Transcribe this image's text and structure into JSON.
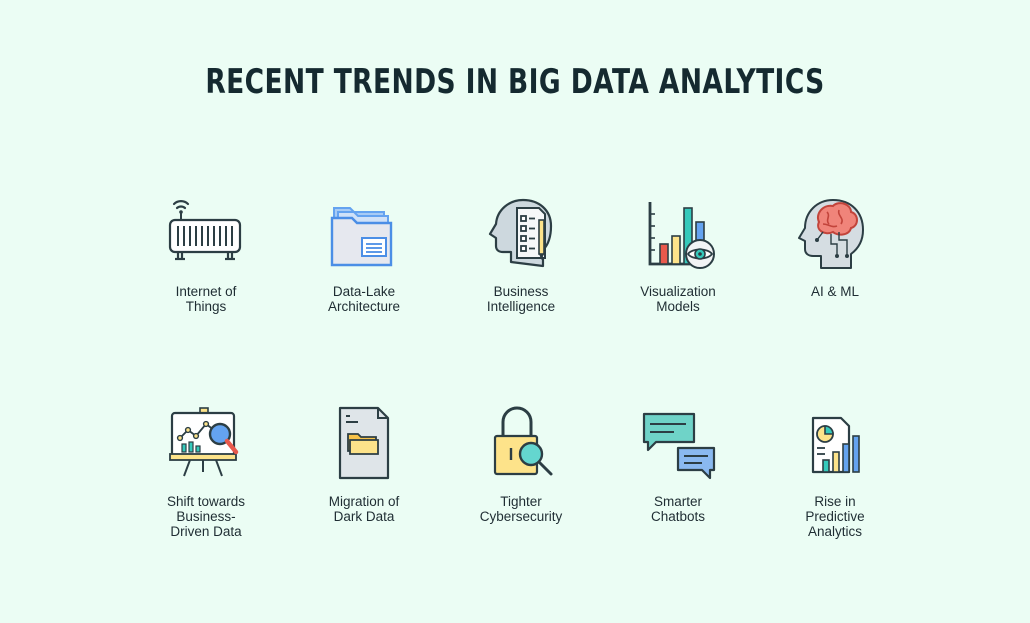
{
  "title": "RECENT TRENDS IN BIG DATA ANALYTICS",
  "colors": {
    "background": "#ebfdf4",
    "title": "#152a30",
    "stroke": "#2c3e44",
    "blue": "#64a3f0",
    "teal": "#35c9bb",
    "yellow": "#fde38a",
    "red": "#e8594c",
    "pink": "#f0847a"
  },
  "trends": [
    {
      "icon": "router-icon",
      "lines": [
        "Internet of",
        "Things"
      ]
    },
    {
      "icon": "folder-icon",
      "lines": [
        "Data-Lake",
        "Architecture"
      ]
    },
    {
      "icon": "head-checklist-icon",
      "lines": [
        "Business",
        "Intelligence"
      ]
    },
    {
      "icon": "chart-eye-icon",
      "lines": [
        "Visualization",
        "Models"
      ]
    },
    {
      "icon": "brain-head-icon",
      "lines": [
        "AI & ML"
      ]
    },
    {
      "icon": "presentation-board-icon",
      "lines": [
        "Shift towards",
        "Business-",
        "Driven Data"
      ]
    },
    {
      "icon": "document-folder-icon",
      "lines": [
        "Migration of",
        "Dark Data"
      ]
    },
    {
      "icon": "padlock-search-icon",
      "lines": [
        "Tighter",
        "Cybersecurity"
      ]
    },
    {
      "icon": "chat-bubbles-icon",
      "lines": [
        "Smarter",
        "Chatbots"
      ]
    },
    {
      "icon": "report-chart-icon",
      "lines": [
        "Rise in",
        "Predictive",
        "Analytics"
      ]
    }
  ]
}
